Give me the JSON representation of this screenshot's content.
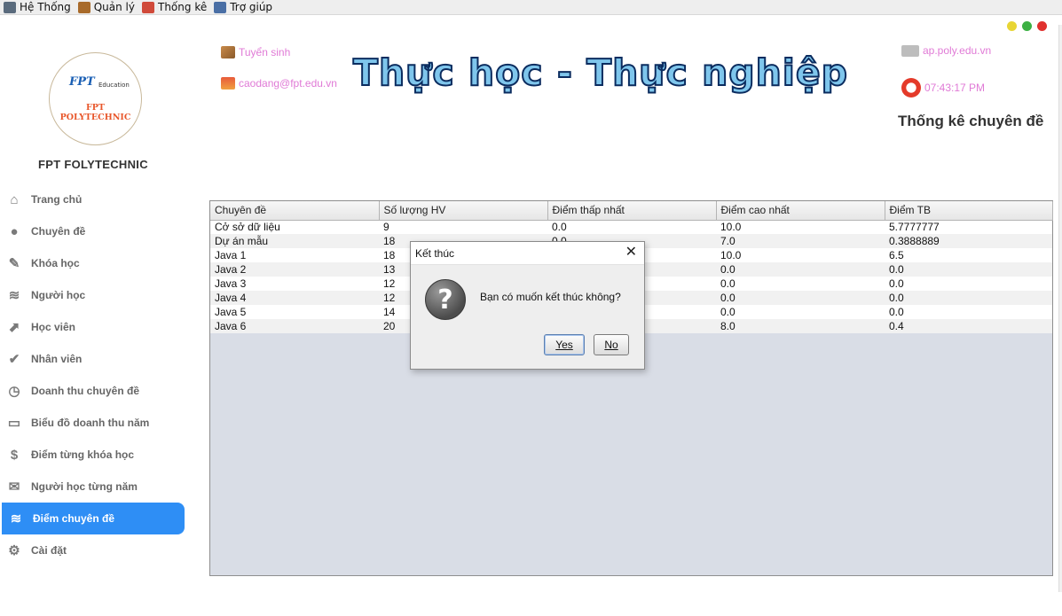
{
  "menubar": {
    "items": [
      {
        "label": "Hệ Thống",
        "icon": "system-icon",
        "color": "#5a6b7d"
      },
      {
        "label": "Quản lý",
        "icon": "manage-icon",
        "color": "#a86a2a"
      },
      {
        "label": "Thống kê",
        "icon": "stats-icon",
        "color": "#d04a3a"
      },
      {
        "label": "Trợ giúp",
        "icon": "help-user-icon",
        "color": "#4a6fa5"
      }
    ]
  },
  "window": {
    "dots": [
      "#e8d534",
      "#3cb043",
      "#e0312e"
    ]
  },
  "logo": {
    "fpt": "FPT",
    "education": "Education",
    "polytechnic": "FPT POLYTECHNIC"
  },
  "brand": "FPT FOLYTECHNIC",
  "header": {
    "admissions": "Tuyển sinh",
    "email": "caodang@fpt.edu.vn",
    "slogan": "Thực học - Thực nghiệp",
    "website": "ap.poly.edu.vn",
    "clock": "07:43:17 PM",
    "page_title": "Thống kê chuyên đề"
  },
  "sidebar": {
    "items": [
      {
        "label": "Trang chủ",
        "icon": "home-icon"
      },
      {
        "label": "Chuyên đề",
        "icon": "topic-icon"
      },
      {
        "label": "Khóa học",
        "icon": "course-icon"
      },
      {
        "label": "Người học",
        "icon": "learner-icon"
      },
      {
        "label": "Học viên",
        "icon": "student-icon"
      },
      {
        "label": "Nhân viên",
        "icon": "staff-icon"
      },
      {
        "label": "Doanh thu chuyên đề",
        "icon": "revenue-clock-icon"
      },
      {
        "label": "Biểu đồ doanh thu năm",
        "icon": "revenue-chart-icon"
      },
      {
        "label": "Điểm từng khóa học",
        "icon": "course-score-icon"
      },
      {
        "label": "Người học từng năm",
        "icon": "yearly-learner-icon"
      },
      {
        "label": "Điểm chuyên đề",
        "icon": "topic-score-icon"
      },
      {
        "label": "Cài đặt",
        "icon": "settings-gear-icon"
      }
    ],
    "active_index": 10,
    "accent": "#2e8ef5"
  },
  "table": {
    "columns": [
      "Chuyên đề",
      "Số lượng HV",
      "Điểm thấp nhất",
      "Điểm cao nhất",
      "Điểm TB"
    ],
    "rows": [
      [
        "Cở sở dữ liệu",
        "9",
        "0.0",
        "10.0",
        "5.7777777"
      ],
      [
        "Dự án mẫu",
        "18",
        "0.0",
        "7.0",
        "0.3888889"
      ],
      [
        "Java 1",
        "18",
        "",
        "10.0",
        "6.5"
      ],
      [
        "Java 2",
        "13",
        "",
        "0.0",
        "0.0"
      ],
      [
        "Java 3",
        "12",
        "",
        "0.0",
        "0.0"
      ],
      [
        "Java 4",
        "12",
        "",
        "0.0",
        "0.0"
      ],
      [
        "Java 5",
        "14",
        "",
        "0.0",
        "0.0"
      ],
      [
        "Java 6",
        "20",
        "",
        "8.0",
        "0.4"
      ]
    ]
  },
  "dialog": {
    "title": "Kết thúc",
    "message": "Bạn có muốn kết thúc không?",
    "icon_glyph": "?",
    "yes": "Yes",
    "no": "No"
  }
}
